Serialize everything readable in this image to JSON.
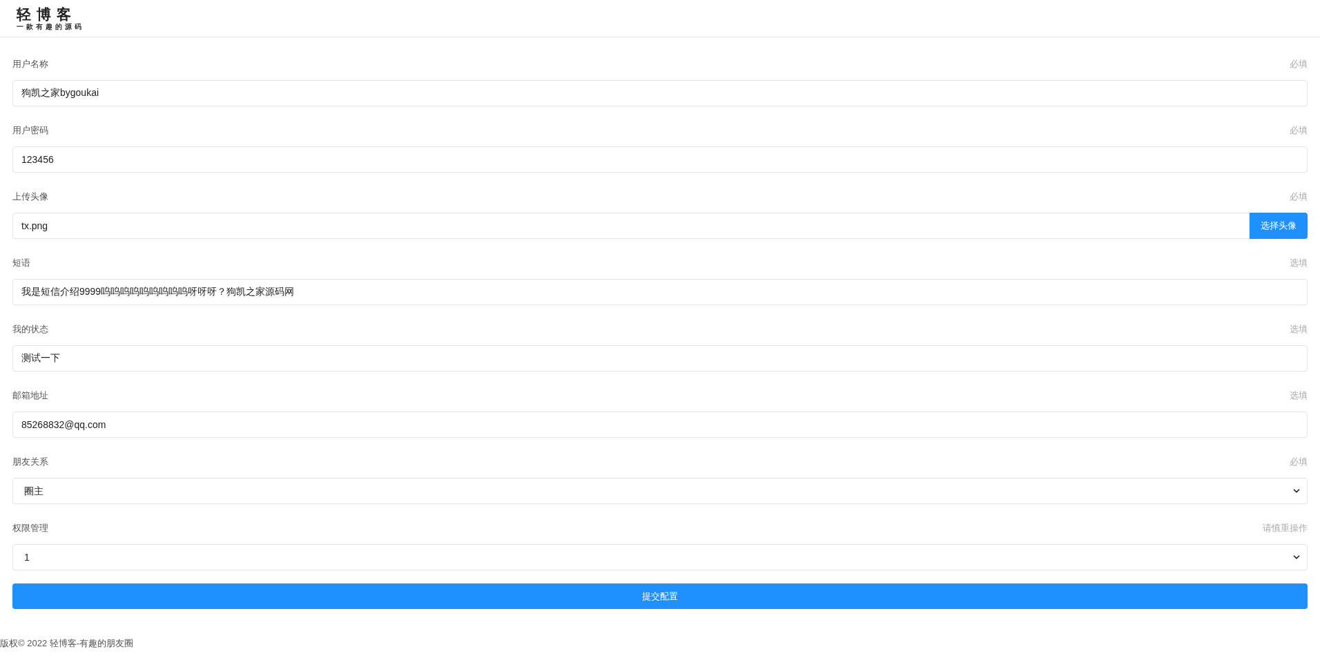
{
  "logo": {
    "title": "轻博客",
    "tagline": "一款有趣的源码"
  },
  "form": {
    "fields": [
      {
        "label": "用户名称",
        "hint": "必填",
        "kind": "text",
        "value": "狗凯之家bygoukai"
      },
      {
        "label": "用户密码",
        "hint": "必填",
        "kind": "text",
        "value": "123456"
      },
      {
        "label": "上传头像",
        "hint": "必填",
        "kind": "file",
        "value": "tx.png",
        "button": "选择头像"
      },
      {
        "label": "短语",
        "hint": "选填",
        "kind": "text",
        "value": "我是短信介绍9999呜呜呜呜呜呜呜呜呜呀呀呀？狗凯之家源码网"
      },
      {
        "label": "我的状态",
        "hint": "选填",
        "kind": "text",
        "value": "测试一下"
      },
      {
        "label": "邮箱地址",
        "hint": "选填",
        "kind": "text",
        "value": "85268832@qq.com"
      },
      {
        "label": "朋友关系",
        "hint": "必填",
        "kind": "select",
        "value": "圈主"
      },
      {
        "label": "权限管理",
        "hint": "请慎重操作",
        "kind": "select",
        "value": "1"
      }
    ],
    "submit": "提交配置"
  },
  "footer": "版权© 2022 轻博客-有趣的朋友圈"
}
